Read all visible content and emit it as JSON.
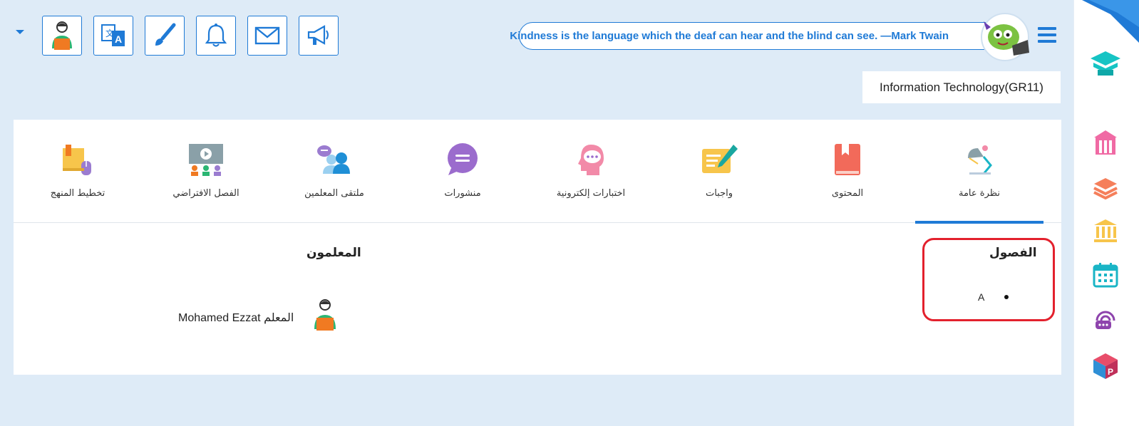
{
  "header": {
    "quote": "Kindness is the language which the deaf can hear and the blind can see. —Mark Twain",
    "course_title": "Information Technology(GR11)"
  },
  "toolbar": {
    "buttons": [
      {
        "name": "profile-avatar-icon"
      },
      {
        "name": "translate-icon"
      },
      {
        "name": "paintbrush-icon"
      },
      {
        "name": "bell-icon"
      },
      {
        "name": "mail-icon"
      },
      {
        "name": "megaphone-icon"
      }
    ]
  },
  "tabs": [
    {
      "label": "نظرة عامة",
      "icon": "overview-lamp-icon",
      "active": true
    },
    {
      "label": "المحتوى",
      "icon": "book-icon"
    },
    {
      "label": "واجبات",
      "icon": "assignment-icon"
    },
    {
      "label": "اختبارات إلكترونية",
      "icon": "quiz-head-icon"
    },
    {
      "label": "منشورات",
      "icon": "chat-bubble-icon"
    },
    {
      "label": "ملتقى المعلمين",
      "icon": "teachers-forum-icon"
    },
    {
      "label": "الفصل الافتراضي",
      "icon": "virtual-class-icon"
    },
    {
      "label": "تخطيط المنهج",
      "icon": "curriculum-planning-icon"
    }
  ],
  "classes": {
    "heading": "الفصول",
    "items": [
      "A"
    ]
  },
  "teachers": {
    "heading": "المعلمون",
    "items": [
      {
        "name": "Mohamed Ezzat المعلم"
      }
    ]
  },
  "sidebar": {
    "icons": [
      "school-building-icon",
      "books-stack-icon",
      "institution-icon",
      "calendar-icon",
      "podcast-icon",
      "app-cube-icon"
    ]
  },
  "colors": {
    "accent": "#1f7ad6",
    "background": "#deebf7",
    "highlight_border": "#e3212d"
  }
}
